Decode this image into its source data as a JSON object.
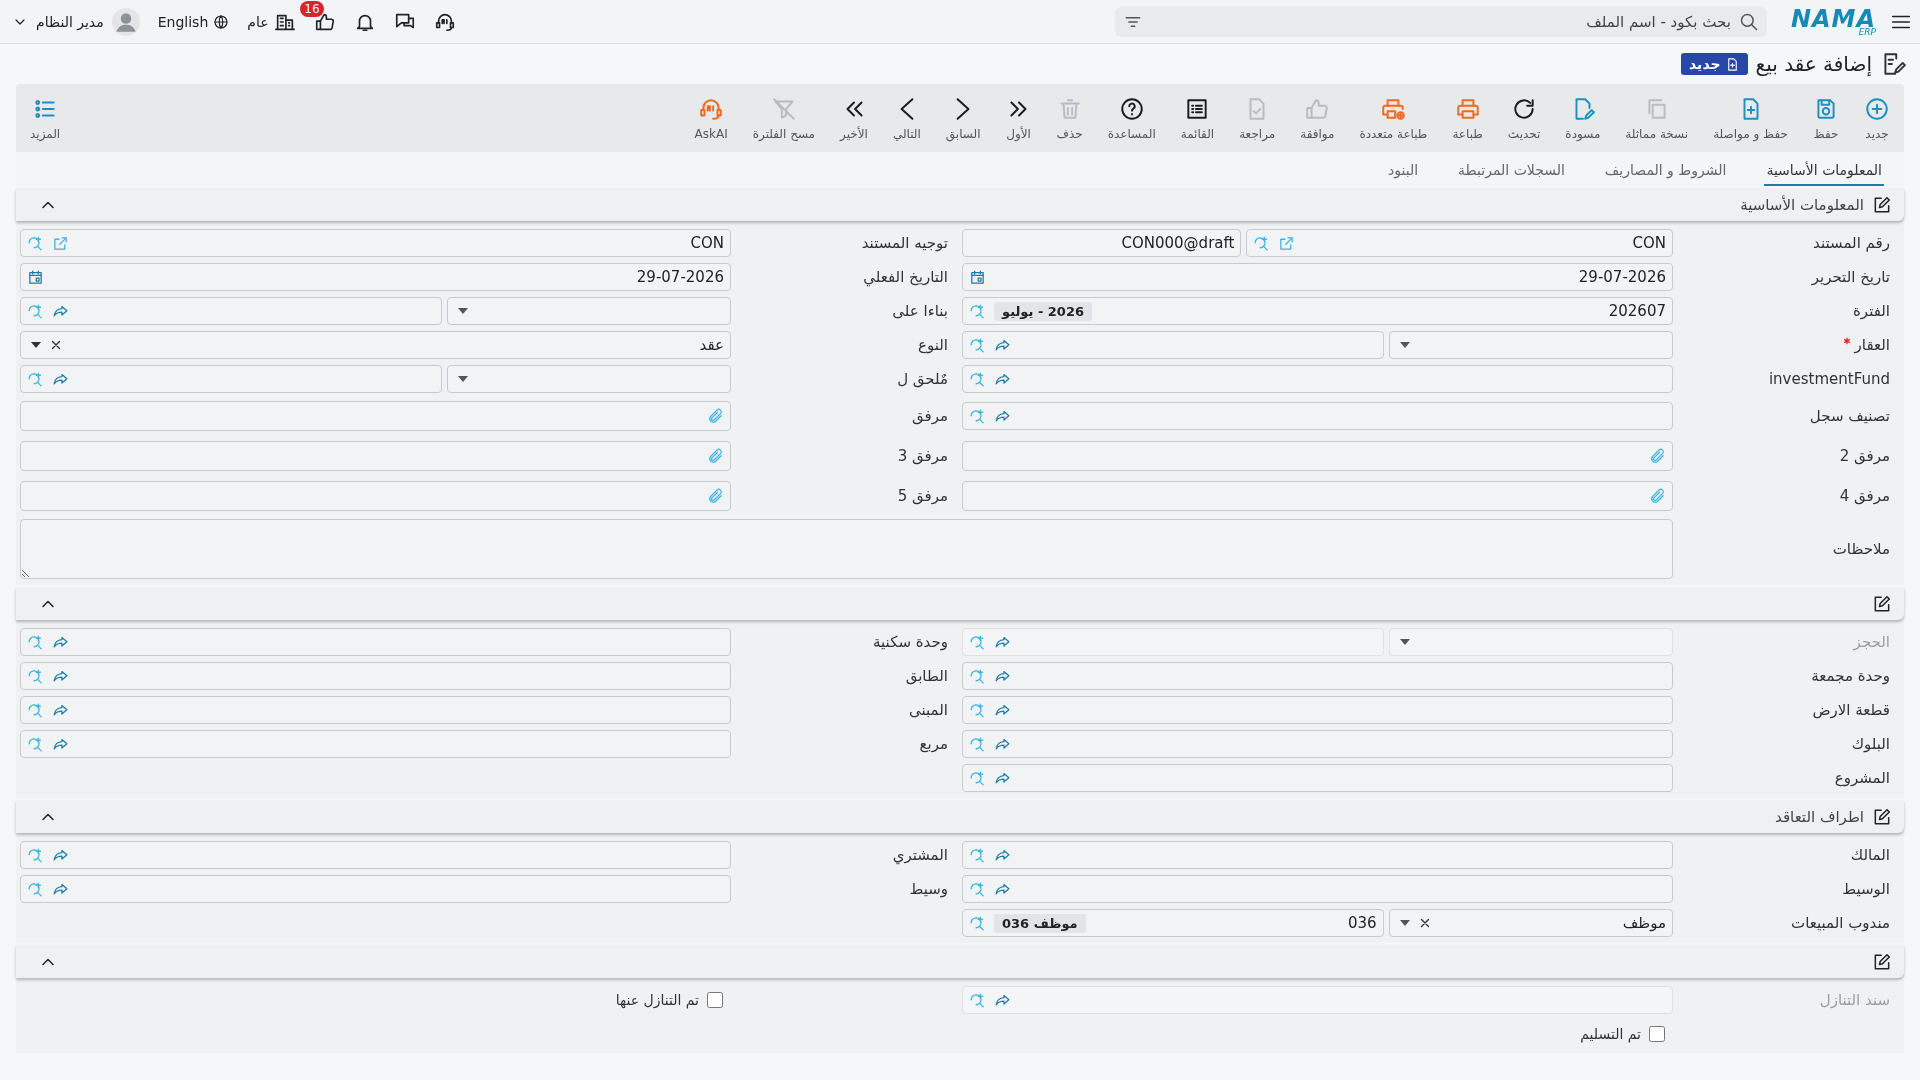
{
  "topbar": {
    "logo": {
      "name": "NAMA",
      "sub": "ERP"
    },
    "search": {
      "placeholder": "بحث بكود - اسم الملف"
    },
    "notifications_badge": "16",
    "company": "عام",
    "language": "English",
    "user": "مدير النظام"
  },
  "page": {
    "title": "إضافة عقد بيع",
    "new_button": "جديد"
  },
  "toolbar": [
    {
      "label": "جديد",
      "kind": "add",
      "disabled": false
    },
    {
      "label": "حفظ",
      "kind": "save",
      "disabled": false
    },
    {
      "label": "حفظ و مواصلة",
      "kind": "save-continue",
      "disabled": false
    },
    {
      "label": "نسخة مماثلة",
      "kind": "duplicate",
      "disabled": true
    },
    {
      "label": "مسودة",
      "kind": "draft",
      "disabled": false
    },
    {
      "label": "تحديث",
      "kind": "refresh",
      "disabled": false
    },
    {
      "label": "طباعة",
      "kind": "print",
      "disabled": false
    },
    {
      "label": "طباعة متعددة",
      "kind": "print-multi",
      "disabled": false
    },
    {
      "label": "موافقة",
      "kind": "approve",
      "disabled": true
    },
    {
      "label": "مراجعة",
      "kind": "review",
      "disabled": true
    },
    {
      "label": "القائمة",
      "kind": "list",
      "disabled": false
    },
    {
      "label": "المساعدة",
      "kind": "help",
      "disabled": false
    },
    {
      "label": "حذف",
      "kind": "delete",
      "disabled": true
    },
    {
      "label": "الأول",
      "kind": "first",
      "disabled": false
    },
    {
      "label": "السابق",
      "kind": "previous",
      "disabled": false
    },
    {
      "label": "التالي",
      "kind": "next",
      "disabled": false
    },
    {
      "label": "الأخير",
      "kind": "last",
      "disabled": false
    },
    {
      "label": "مسح الفلترة",
      "kind": "clear-filter",
      "disabled": true
    },
    {
      "label": "AskAI",
      "kind": "ask-ai",
      "disabled": false
    }
  ],
  "more": {
    "label": "المزيد"
  },
  "tabs": [
    {
      "label": "المعلومات الأساسية",
      "selected": true
    },
    {
      "label": "الشروط و المصاريف",
      "selected": false
    },
    {
      "label": "السجلات المرتبطة",
      "selected": false
    },
    {
      "label": "البنود",
      "selected": false
    }
  ],
  "sections": [
    {
      "title": "المعلومات الأساسية",
      "expanded": true,
      "rows": [
        [
          {
            "label": "رقم المستند",
            "kind": "code",
            "value": "CON",
            "code": "CON000@draft",
            "required": false,
            "disabled": false
          },
          {
            "label": "توجيه المستند",
            "kind": "link",
            "value": "CON",
            "required": false,
            "disabled": false
          }
        ],
        [
          {
            "label": "تاريخ التحرير",
            "kind": "date",
            "value": "29-07-2026",
            "required": false,
            "disabled": false
          },
          {
            "label": "التاريخ الفعلي",
            "kind": "date",
            "value": "29-07-2026",
            "required": false,
            "disabled": false
          }
        ],
        [
          {
            "label": "الفترة",
            "kind": "period",
            "value": "202607",
            "tag": "2026 - يوليو",
            "required": false,
            "disabled": false
          },
          {
            "label": "بناءا على",
            "kind": "split",
            "required": false,
            "disabled": false
          }
        ],
        [
          {
            "label": "العقار",
            "kind": "split",
            "required": true,
            "disabled": false
          },
          {
            "label": "النوع",
            "kind": "select",
            "value": "عقد",
            "required": false,
            "disabled": false
          }
        ],
        [
          {
            "label": "investmentFund",
            "kind": "lookup",
            "required": false,
            "disabled": false
          },
          {
            "label": "مٌلحق ل",
            "kind": "split",
            "required": false,
            "disabled": false
          }
        ],
        [
          {
            "label": "تصنيف سجل",
            "kind": "lookup",
            "required": false,
            "disabled": false
          },
          {
            "label": "مرفق",
            "kind": "attachment",
            "required": false,
            "disabled": false
          }
        ],
        [
          {
            "label": "مرفق 2",
            "kind": "attachment",
            "required": false,
            "disabled": false
          },
          {
            "label": "مرفق 3",
            "kind": "attachment",
            "required": false,
            "disabled": false
          }
        ],
        [
          {
            "label": "مرفق 4",
            "kind": "attachment",
            "required": false,
            "disabled": false
          },
          {
            "label": "مرفق 5",
            "kind": "attachment",
            "required": false,
            "disabled": false
          }
        ],
        [
          {
            "label": "ملاحظات",
            "kind": "notes",
            "required": false,
            "disabled": false
          }
        ]
      ]
    },
    {
      "expanded": true,
      "rows": [
        [
          {
            "label": "الحجز",
            "kind": "split",
            "required": false,
            "disabled": true
          },
          {
            "label": "وحدة سكنية",
            "kind": "lookup",
            "required": false,
            "disabled": false
          }
        ],
        [
          {
            "label": "وحدة مجمعة",
            "kind": "lookup",
            "required": false,
            "disabled": false
          },
          {
            "label": "الطابق",
            "kind": "lookup",
            "required": false,
            "disabled": false
          }
        ],
        [
          {
            "label": "قطعة الارض",
            "kind": "lookup",
            "required": false,
            "disabled": false
          },
          {
            "label": "المبنى",
            "kind": "lookup",
            "required": false,
            "disabled": false
          }
        ],
        [
          {
            "label": "البلوك",
            "kind": "lookup",
            "required": false,
            "disabled": false
          },
          {
            "label": "مربع",
            "kind": "lookup",
            "required": false,
            "disabled": false
          }
        ],
        [
          {
            "label": "المشروع",
            "kind": "lookup",
            "required": false,
            "disabled": false
          }
        ]
      ]
    },
    {
      "title": "اطراف التعاقد",
      "expanded": true,
      "rows": [
        [
          {
            "label": "المالك",
            "kind": "lookup",
            "required": false,
            "disabled": false
          },
          {
            "label": "المشتري",
            "kind": "lookup",
            "required": false,
            "disabled": false
          }
        ],
        [
          {
            "label": "الوسيط",
            "kind": "lookup",
            "required": false,
            "disabled": false
          },
          {
            "label": "وسيط",
            "kind": "lookup",
            "required": false,
            "disabled": false
          }
        ],
        [
          {
            "label": "مندوب المبيعات",
            "kind": "employee",
            "value": "موظف",
            "code": "036",
            "tag": "موظف 036",
            "required": false,
            "disabled": false
          }
        ]
      ]
    },
    {
      "expanded": true,
      "rows": [
        [
          {
            "label": "سند التنازل",
            "kind": "lookup",
            "required": false,
            "disabled": true
          },
          {
            "label": "تم التنازل عنها",
            "kind": "checkbox",
            "checked": false
          }
        ],
        [
          {
            "label": "تم التسليم",
            "kind": "checkbox",
            "checked": false
          }
        ]
      ]
    }
  ]
}
